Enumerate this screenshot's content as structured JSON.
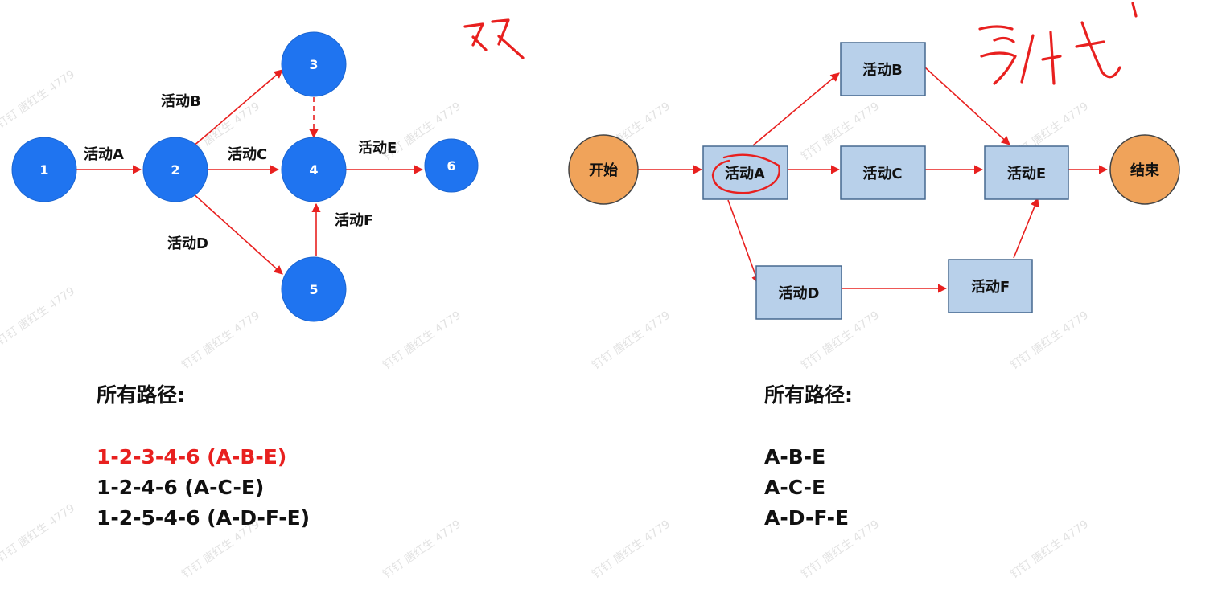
{
  "left_network": {
    "nodes": [
      "1",
      "2",
      "3",
      "4",
      "5",
      "6"
    ],
    "edges": {
      "a": "活动A",
      "b": "活动B",
      "c": "活动C",
      "d": "活动D",
      "e": "活动E",
      "f": "活动F"
    },
    "paths_title": "所有路径:",
    "paths": [
      "1-2-3-4-6  (A-B-E)",
      "1-2-4-6  (A-C-E)",
      "1-2-5-4-6  (A-D-F-E)"
    ]
  },
  "right_network": {
    "start": "开始",
    "end": "结束",
    "boxes": {
      "a": "活动A",
      "b": "活动B",
      "c": "活动C",
      "d": "活动D",
      "e": "活动E",
      "f": "活动F"
    },
    "paths_title": "所有路径:",
    "paths": [
      "A-B-E",
      "A-C-E",
      "A-D-F-E"
    ]
  },
  "watermark": "钉钉 唐红生 4779",
  "colors": {
    "node_blue": "#1f74f0",
    "arrow_red": "#e8201f",
    "box_fill": "#b8d0ea",
    "box_border": "#46688f",
    "start_end_fill": "#f0a35a",
    "highlight_path": "#e8201f"
  }
}
